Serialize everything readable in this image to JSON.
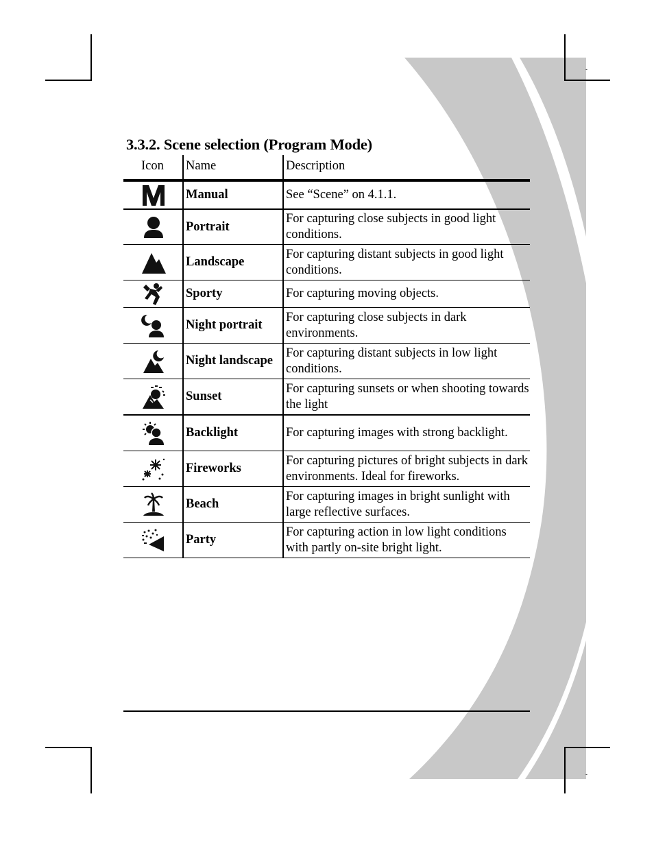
{
  "page": {
    "section_title": "3.3.2. Scene selection (Program Mode)",
    "decoration_color": "#c8c8c8"
  },
  "table": {
    "headers": {
      "icon": "Icon",
      "name": "Name",
      "description": "Description"
    },
    "rows": [
      {
        "icon": "manual-m-icon",
        "name": "Manual",
        "description": "See “Scene” on 4.1.1."
      },
      {
        "icon": "portrait-icon",
        "name": "Portrait",
        "description": "For capturing close subjects in good light conditions."
      },
      {
        "icon": "landscape-mountain-icon",
        "name": "Landscape",
        "description": "For capturing distant subjects in good light conditions."
      },
      {
        "icon": "sporty-runner-icon",
        "name": "Sporty",
        "description": "For capturing moving objects."
      },
      {
        "icon": "night-portrait-icon",
        "name": "Night portrait",
        "description": "For capturing close subjects in dark environments."
      },
      {
        "icon": "night-landscape-icon",
        "name": "Night landscape",
        "description": "For capturing distant subjects in low light conditions."
      },
      {
        "icon": "sunset-icon",
        "name": "Sunset",
        "description": "For capturing sunsets or when shooting towards the light"
      },
      {
        "icon": "backlight-icon",
        "name": "Backlight",
        "description": "For capturing images with strong backlight."
      },
      {
        "icon": "fireworks-icon",
        "name": "Fireworks",
        "description": "For capturing pictures of bright subjects in dark environments. Ideal for fireworks."
      },
      {
        "icon": "beach-palm-icon",
        "name": "Beach",
        "description": "For capturing images in bright sunlight with large reflective surfaces."
      },
      {
        "icon": "party-icon",
        "name": "Party",
        "description": "For capturing action in low light conditions with partly on-site bright light."
      }
    ]
  },
  "crop_marks": {
    "top_right_tick": "-",
    "bottom_right_tick": "-"
  }
}
